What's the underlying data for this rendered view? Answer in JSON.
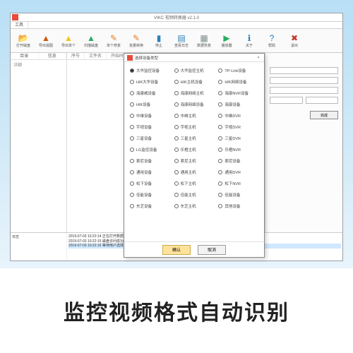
{
  "window": {
    "title": "VIKC 视频转换器 v2.1.0"
  },
  "tabs": [
    "工具"
  ],
  "toolbar": [
    {
      "icon": "📂",
      "color": "#d35400",
      "label": "打开磁盘"
    },
    {
      "icon": "▲",
      "color": "#d35400",
      "label": "导出视图"
    },
    {
      "icon": "▲",
      "color": "#f1c40f",
      "label": "导出单个"
    },
    {
      "icon": "▲",
      "color": "#27ae60",
      "label": "扫描磁盘"
    },
    {
      "icon": "✎",
      "color": "#e67e22",
      "label": "单个修复"
    },
    {
      "icon": "✎",
      "color": "#e67e22",
      "label": "批量转换"
    },
    {
      "icon": "▮",
      "color": "#2980b9",
      "label": "停止"
    },
    {
      "icon": "▤",
      "color": "#2980b9",
      "label": "查看日志"
    },
    {
      "icon": "▦",
      "color": "#7f8c8d",
      "label": "数据恢复"
    },
    {
      "icon": "▶",
      "color": "#27ae60",
      "label": "播放器"
    },
    {
      "icon": "ℹ",
      "color": "#2980b9",
      "label": "关于"
    },
    {
      "icon": "?",
      "color": "#2980b9",
      "label": "帮助"
    },
    {
      "icon": "✖",
      "color": "#c0392b",
      "label": "退出"
    }
  ],
  "side_tabs": [
    "目录",
    "信息"
  ],
  "side_label": "详细",
  "grid_cols": [
    "序号",
    "文件名",
    "开始时间"
  ],
  "right": {
    "btn": "完成"
  },
  "log_left_head": "日志",
  "log_lines": [
    "2019-07-03 10:22:14  正在打开数据源",
    "2019-07-03 10:22:15  磁盘访问成功",
    "2019-07-03 10:22:16  等待用户选择格式类型…"
  ],
  "dialog": {
    "title": "选择设备类型",
    "options": [
      "大华监控设备",
      "大华监控主机",
      "TP-Link设备",
      "HIK大华设备",
      "HIK主机设备",
      "HIK网络设备",
      "海康威设备",
      "海康网络主机",
      "海康NVR设备",
      "HIK设备",
      "海康网络设备",
      "海康设备",
      "中维设备",
      "中维主机",
      "中维DVR",
      "宇视设备",
      "宇视主机",
      "宇视DVR",
      "三星设备",
      "三星主机",
      "三星DVR",
      "LG监控设备",
      "乐橙主机",
      "乐橙NVR",
      "索尼设备",
      "索尼主机",
      "索尼设备",
      "通用设备",
      "通用主机",
      "通用DVR",
      "松下设备",
      "松下主机",
      "松下NVR",
      "佳能设备",
      "佳能主机",
      "佳能设备",
      "东芝设备",
      "东芝主机",
      "其他设备"
    ],
    "ok": "确认",
    "cancel": "取消"
  },
  "caption": "监控视频格式自动识别"
}
